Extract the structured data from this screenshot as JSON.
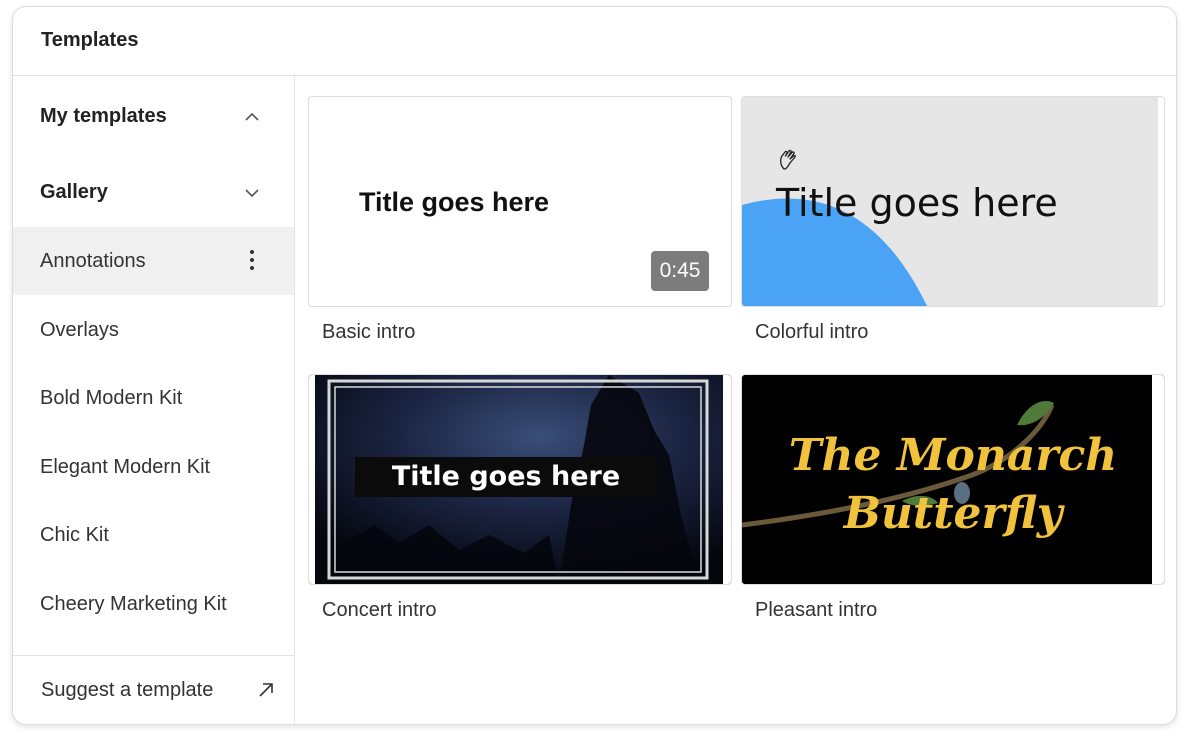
{
  "window": {
    "title": "Templates"
  },
  "sidebar": {
    "sections": [
      {
        "label": "My templates",
        "state": "expanded"
      },
      {
        "label": "Gallery",
        "state": "collapsed"
      }
    ],
    "items": [
      {
        "label": "Annotations",
        "active": true
      },
      {
        "label": "Overlays"
      },
      {
        "label": "Bold Modern Kit"
      },
      {
        "label": "Elegant Modern Kit"
      },
      {
        "label": "Chic Kit"
      },
      {
        "label": "Cheery Marketing Kit"
      }
    ],
    "suggest_label": "Suggest a template"
  },
  "templates": [
    {
      "caption": "Basic intro",
      "preview_title": "Title goes here",
      "duration": "0:45"
    },
    {
      "caption": "Colorful intro",
      "preview_title": "Title goes here"
    },
    {
      "caption": "Concert intro",
      "preview_title": "Title goes here"
    },
    {
      "caption": "Pleasant intro",
      "preview_title_line1": "The Monarch",
      "preview_title_line2": "Butterfly"
    }
  ],
  "colors": {
    "accent_blue": "#4aa3f4",
    "gold": "#f1c33d",
    "active_bg": "#f0f0f0"
  }
}
